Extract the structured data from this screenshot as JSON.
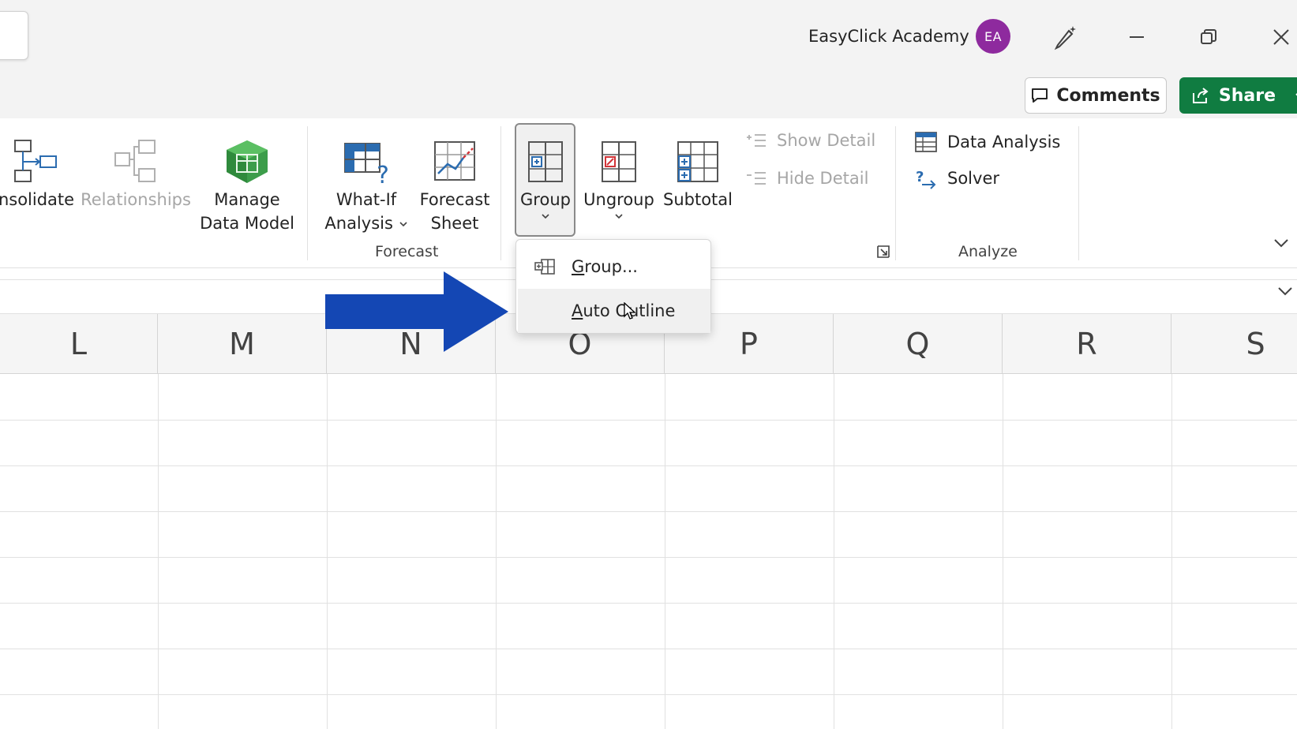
{
  "titlebar": {
    "account_name": "EasyClick Academy",
    "avatar_initials": "EA",
    "avatar_color": "#8e2a9e",
    "comments_label": "Comments",
    "share_label": "Share",
    "share_color": "#107c41"
  },
  "ribbon": {
    "consolidate_label": "nsolidate",
    "relationships_label": "Relationships",
    "manage_data_model_label": "Manage\nData Model",
    "what_if_line1": "What-If",
    "what_if_line2": "Analysis",
    "forecast_sheet_line1": "Forecast",
    "forecast_sheet_line2": "Sheet",
    "forecast_group_label": "Forecast",
    "group_label": "Group",
    "ungroup_label": "Ungroup",
    "subtotal_label": "Subtotal",
    "show_detail_label": "Show Detail",
    "hide_detail_label": "Hide Detail",
    "data_analysis_label": "Data Analysis",
    "solver_label": "Solver",
    "analyze_group_label": "Analyze"
  },
  "dropdown": {
    "items": [
      {
        "label": "Group...",
        "accel": "G",
        "rest": "roup..."
      },
      {
        "label": "Auto Outline",
        "accel": "A",
        "rest": "uto Outline"
      }
    ]
  },
  "grid": {
    "columns": [
      "L",
      "M",
      "N",
      "O",
      "P",
      "Q",
      "R",
      "S"
    ]
  }
}
